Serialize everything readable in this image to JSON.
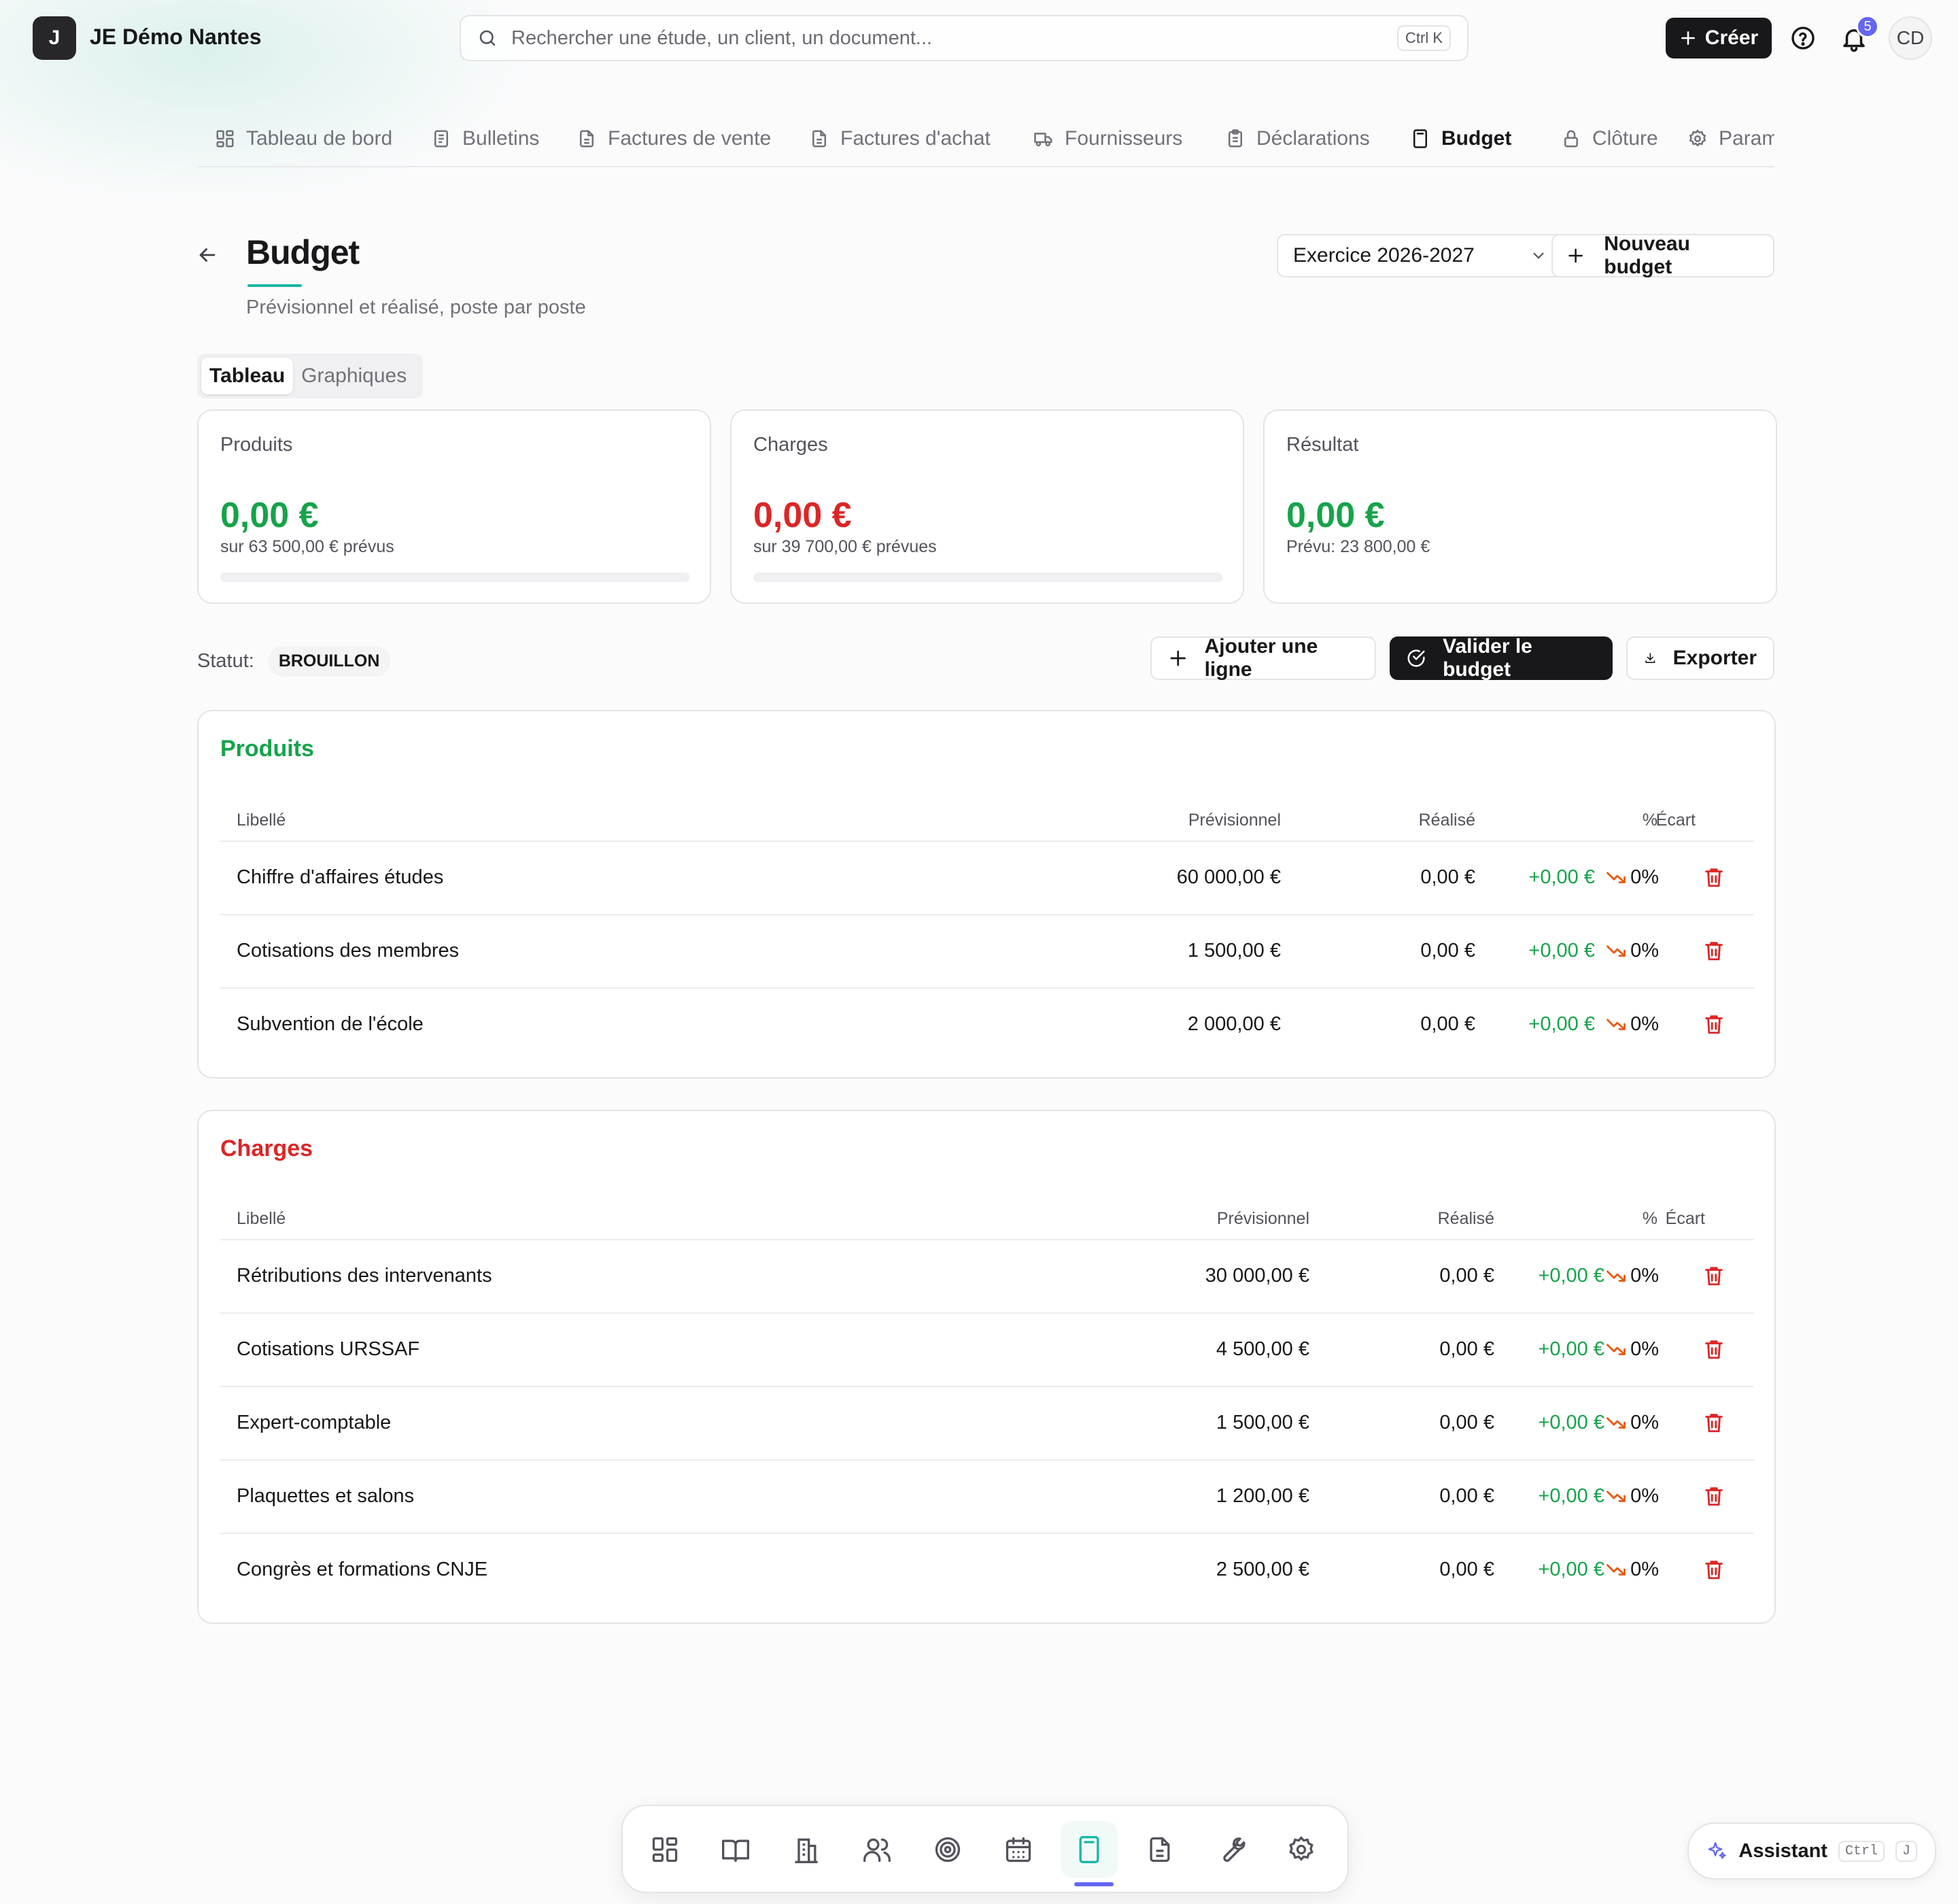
{
  "org": {
    "initial": "J",
    "name": "JE Démo Nantes"
  },
  "search": {
    "placeholder": "Rechercher une étude, un client, un document...",
    "shortcut": "Ctrl K"
  },
  "top": {
    "create_label": "Créer",
    "notifications": "5",
    "avatar": "CD"
  },
  "tabs": [
    {
      "label": "Tableau de bord",
      "icon": "grid-icon"
    },
    {
      "label": "Bulletins",
      "icon": "document-icon"
    },
    {
      "label": "Factures de vente",
      "icon": "file-text-icon"
    },
    {
      "label": "Factures d'achat",
      "icon": "file-text-icon"
    },
    {
      "label": "Fournisseurs",
      "icon": "truck-icon"
    },
    {
      "label": "Déclarations",
      "icon": "clipboard-icon"
    },
    {
      "label": "Budget",
      "icon": "calculator-icon",
      "active": true
    },
    {
      "label": "Clôture",
      "icon": "lock-icon"
    },
    {
      "label": "Paramètres",
      "icon": "gear-icon"
    }
  ],
  "page": {
    "title": "Budget",
    "subtitle": "Prévisionnel et réalisé, poste par poste",
    "exercise": "Exercice 2026-2027",
    "new_budget": "Nouveau budget"
  },
  "view": {
    "table": "Tableau",
    "charts": "Graphiques"
  },
  "summary": {
    "produits": {
      "label": "Produits",
      "amount": "0,00 €",
      "sub": "sur 63 500,00 € prévus",
      "progress": 0
    },
    "charges": {
      "label": "Charges",
      "amount": "0,00 €",
      "sub": "sur 39 700,00 € prévues",
      "progress": 0
    },
    "resultat": {
      "label": "Résultat",
      "amount": "0,00 €",
      "sub": "Prévu: 23 800,00 €"
    }
  },
  "status": {
    "label": "Statut:",
    "value": "BROUILLON"
  },
  "actions": {
    "add_line": "Ajouter une ligne",
    "validate": "Valider le budget",
    "export": "Exporter"
  },
  "columns": {
    "libelle": "Libellé",
    "previsionnel": "Prévisionnel",
    "realise": "Réalisé",
    "ecart": "Écart",
    "pct": "%"
  },
  "produits": {
    "title": "Produits",
    "rows": [
      {
        "libelle": "Chiffre d'affaires études",
        "previsionnel": "60 000,00 €",
        "realise": "0,00 €",
        "ecart": "+0,00 €",
        "pct": "0%"
      },
      {
        "libelle": "Cotisations des membres",
        "previsionnel": "1 500,00 €",
        "realise": "0,00 €",
        "ecart": "+0,00 €",
        "pct": "0%"
      },
      {
        "libelle": "Subvention de l'école",
        "previsionnel": "2 000,00 €",
        "realise": "0,00 €",
        "ecart": "+0,00 €",
        "pct": "0%"
      }
    ]
  },
  "charges": {
    "title": "Charges",
    "rows": [
      {
        "libelle": "Rétributions des intervenants",
        "previsionnel": "30 000,00 €",
        "realise": "0,00 €",
        "ecart": "+0,00 €",
        "pct": "0%"
      },
      {
        "libelle": "Cotisations URSSAF",
        "previsionnel": "4 500,00 €",
        "realise": "0,00 €",
        "ecart": "+0,00 €",
        "pct": "0%"
      },
      {
        "libelle": "Expert-comptable",
        "previsionnel": "1 500,00 €",
        "realise": "0,00 €",
        "ecart": "+0,00 €",
        "pct": "0%"
      },
      {
        "libelle": "Plaquettes et salons",
        "previsionnel": "1 200,00 €",
        "realise": "0,00 €",
        "ecart": "+0,00 €",
        "pct": "0%"
      },
      {
        "libelle": "Congrès et formations CNJE",
        "previsionnel": "2 500,00 €",
        "realise": "0,00 €",
        "ecart": "+0,00 €",
        "pct": "0%"
      }
    ]
  },
  "dock": {
    "items": [
      "grid-icon",
      "book-icon",
      "building-icon",
      "users-icon",
      "target-icon",
      "calendar-icon",
      "calculator-icon",
      "file-icon",
      "wrench-icon",
      "gear-icon"
    ],
    "active_index": 6
  },
  "assistant": {
    "label": "Assistant",
    "key1": "Ctrl",
    "key2": "J"
  },
  "colors": {
    "positive": "#16a34a",
    "negative": "#dc2626",
    "accent": "#6366f1",
    "teal": "#14b8a6",
    "dark": "#18181b"
  }
}
